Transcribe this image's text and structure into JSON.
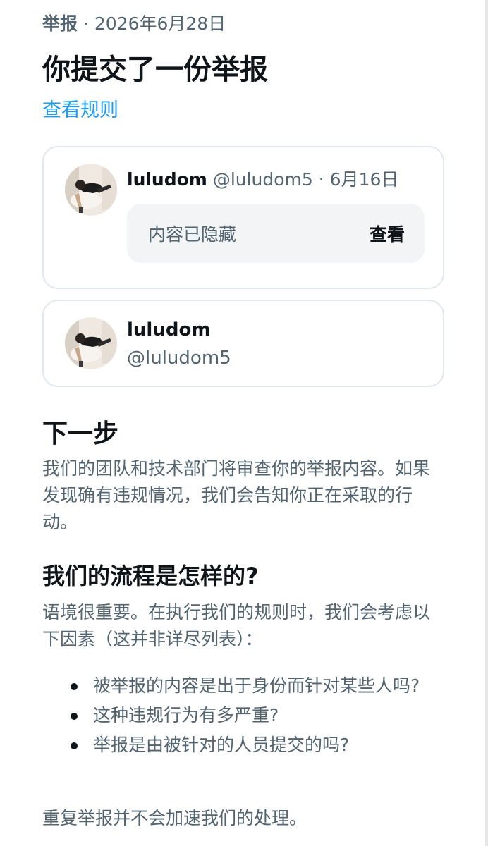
{
  "meta": {
    "category": "举报",
    "separator": " · ",
    "date": "2026年6月28日"
  },
  "title": "你提交了一份举报",
  "rules_link": "查看规则",
  "reported_post": {
    "display_name": "luludom",
    "handle": "@luludom5",
    "separator": " · ",
    "date": "6月16日",
    "hidden_label": "内容已隐藏",
    "view_label": "查看"
  },
  "reported_account": {
    "display_name": "luludom",
    "handle": "@luludom5"
  },
  "next_steps": {
    "heading": "下一步",
    "body": "我们的团队和技术部门将审查你的举报内容。如果发现确有违规情况，我们会告知你正在采取的行动。"
  },
  "process": {
    "heading": "我们的流程是怎样的?",
    "intro": "语境很重要。在执行我们的规则时，我们会考虑以下因素（这并非详尽列表）：",
    "items": [
      "被举报的内容是出于身份而针对某些人吗?",
      "这种违规行为有多严重?",
      "举报是由被针对的人员提交的吗?"
    ],
    "footer": "重复举报并不会加速我们的处理。"
  },
  "colors": {
    "text_primary": "#0f1419",
    "text_secondary": "#536471",
    "link": "#1d9bf0",
    "border": "#e1e8ed",
    "hidden_box_bg": "#f2f4f6"
  }
}
